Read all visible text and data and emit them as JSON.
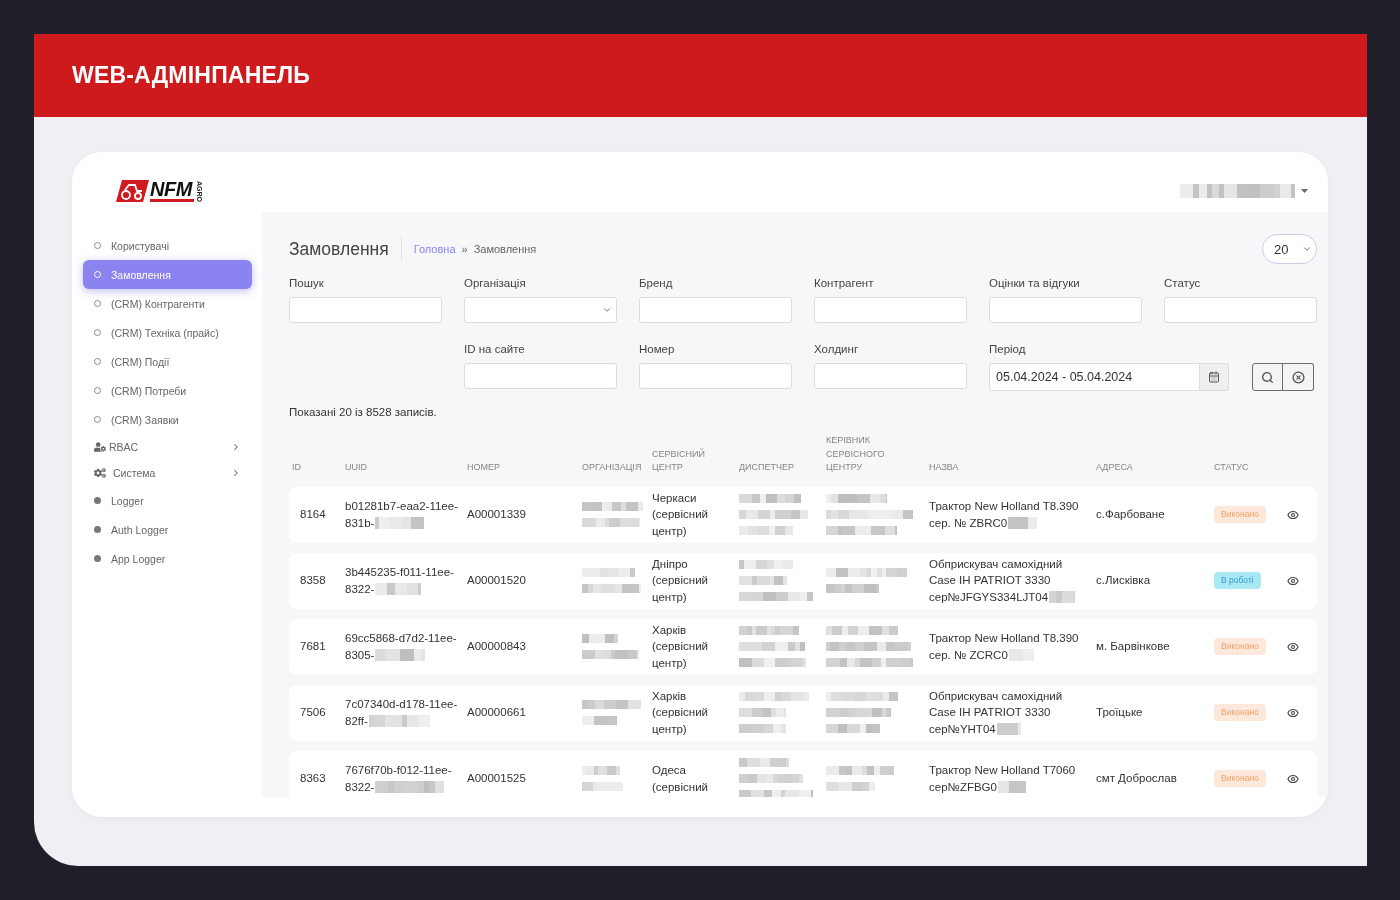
{
  "banner": {
    "title": "WEB-АДМІНПАНЕЛЬ"
  },
  "logo": {
    "text": "NFM",
    "subtext": "AGRO"
  },
  "sidebar": {
    "items": [
      {
        "label": "Користувачі",
        "kind": "page",
        "selected": false
      },
      {
        "label": "Замовлення",
        "kind": "page",
        "selected": true
      },
      {
        "label": "(CRM) Контрагенти",
        "kind": "page",
        "selected": false
      },
      {
        "label": "(CRM) Техніка (прайс)",
        "kind": "page",
        "selected": false
      },
      {
        "label": "(CRM) Події",
        "kind": "page",
        "selected": false
      },
      {
        "label": "(CRM) Потреби",
        "kind": "page",
        "selected": false
      },
      {
        "label": "(CRM) Заявки",
        "kind": "page",
        "selected": false
      },
      {
        "label": "RBAC",
        "kind": "access",
        "selected": false
      },
      {
        "label": "Система",
        "kind": "system",
        "selected": false
      },
      {
        "label": "Logger",
        "kind": "log",
        "selected": false
      },
      {
        "label": "Auth Logger",
        "kind": "log",
        "selected": false
      },
      {
        "label": "App Logger",
        "kind": "log",
        "selected": false
      }
    ]
  },
  "page": {
    "title": "Замовлення",
    "breadcrumb": [
      {
        "label": "Головна",
        "kind": "link"
      },
      {
        "label": "Замовлення",
        "kind": "current"
      }
    ],
    "breadcrumb_separator": "»",
    "page_size": "20"
  },
  "filter_rows": [
    [
      {
        "label": "Пошук",
        "kind": "text"
      },
      {
        "label": "Організація",
        "kind": "select"
      },
      {
        "label": "Бренд",
        "kind": "text"
      },
      {
        "label": "Контрагент",
        "kind": "text"
      },
      {
        "label": "Оцінки та відгуки",
        "kind": "text"
      },
      {
        "label": "Статус",
        "kind": "text"
      }
    ],
    [
      {
        "label": "ID на сайте",
        "kind": "text"
      },
      {
        "label": "Номер",
        "kind": "text"
      },
      {
        "label": "Холдинг",
        "kind": "text"
      },
      {
        "label": "Період",
        "kind": "daterange",
        "value": "05.04.2024 - 05.04.2024"
      }
    ]
  ],
  "summary": "Показані 20 із 8528 записів.",
  "table": {
    "columns": [
      {
        "label": "ID",
        "kind": "id"
      },
      {
        "label": "UUID",
        "kind": "uuid"
      },
      {
        "label": "НОМЕР",
        "kind": "number"
      },
      {
        "label": "ОРГАНІЗАЦІЯ",
        "kind": "blurred"
      },
      {
        "label": "СЕРВІСНИЙ ЦЕНТР",
        "kind": "service_center"
      },
      {
        "label": "ДИСПЕТЧЕР",
        "kind": "blurred"
      },
      {
        "label": "КЕРІВНИК СЕРВІСНОГО ЦЕНТРУ",
        "kind": "blurred"
      },
      {
        "label": "НАЗВА",
        "kind": "name"
      },
      {
        "label": "АДРЕСА",
        "kind": "address"
      },
      {
        "label": "СТАТУС",
        "kind": "status"
      },
      {
        "kind": "view"
      }
    ],
    "rows": [
      {
        "id": "8164",
        "uuid": [
          "b01281b7-eaa2-11ee-",
          "831b-"
        ],
        "number": "A00001339",
        "service_center": "Черкаси (сервісний центр)",
        "name": [
          "Трактор New Holland T8.390",
          "сер. № ZBRC0"
        ],
        "address": "с.Фарбоване",
        "status": {
          "label": "Виконано",
          "kind": "done"
        }
      },
      {
        "id": "8358",
        "uuid": [
          "3b445235-f011-11ee-",
          "8322-"
        ],
        "number": "A00001520",
        "service_center": "Дніпро (сервісний центр)",
        "name": [
          "Обприскувач самохідний",
          "Case IH PATRIOT 3330",
          "сер№JFGYS334LJT04"
        ],
        "address": "с.Лисківка",
        "status": {
          "label": "В роботі",
          "kind": "in_progress"
        }
      },
      {
        "id": "7681",
        "uuid": [
          "69cc5868-d7d2-11ee-",
          "8305-"
        ],
        "number": "A00000843",
        "service_center": "Харків (сервісний центр)",
        "name": [
          "Трактор New Holland T8.390",
          "сер. № ZCRC0"
        ],
        "address": "м. Барвінкове",
        "status": {
          "label": "Виконано",
          "kind": "done"
        }
      },
      {
        "id": "7506",
        "uuid": [
          "7c07340d-d178-11ee-",
          "82ff-"
        ],
        "number": "A00000661",
        "service_center": "Харків (сервісний центр)",
        "name": [
          "Обприскувач самохідний",
          "Case IH PATRIOT 3330",
          "сер№YHT04"
        ],
        "address": "Троїцьке",
        "status": {
          "label": "Виконано",
          "kind": "done"
        }
      },
      {
        "id": "8363",
        "uuid": [
          "7676f70b-f012-11ee-",
          "8322-"
        ],
        "number": "A00001525",
        "service_center": "Одеса (сервісний",
        "name": [
          "Трактор New Holland T7060",
          "сер№ZFBG0"
        ],
        "address": "смт Доброслав",
        "status": {
          "label": "Виконано",
          "kind": "done"
        }
      }
    ]
  }
}
